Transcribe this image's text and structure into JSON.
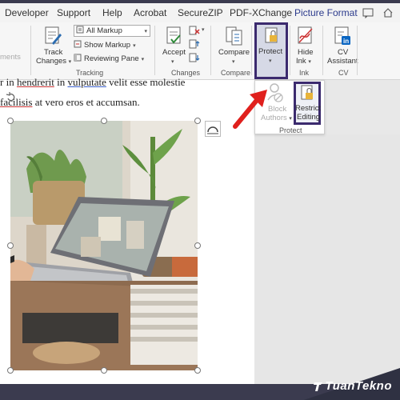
{
  "tabs": [
    "Developer",
    "Support",
    "Help",
    "Acrobat",
    "SecureZIP",
    "PDF-XChange",
    "Picture Format"
  ],
  "ribbon": {
    "comments_partial": "ments",
    "tracking": {
      "track_changes": [
        "Track",
        "Changes"
      ],
      "markup_select": "All Markup",
      "show_markup": "Show Markup",
      "reviewing_pane": "Reviewing Pane",
      "label": "Tracking"
    },
    "changes": {
      "accept": "Accept",
      "label": "Changes"
    },
    "compare": {
      "compare": "Compare",
      "label": "Compare"
    },
    "protect": {
      "protect": "Protect",
      "label": "Protect"
    },
    "ink": {
      "hide_ink": [
        "Hide",
        "Ink"
      ],
      "label": "Ink"
    },
    "cv": {
      "cv_assistant": [
        "CV",
        "Assistant"
      ],
      "label": "CV"
    }
  },
  "dropdown": {
    "block_authors": [
      "Block",
      "Authors"
    ],
    "restrict_editing": [
      "Restrict",
      "Editing"
    ],
    "label": "Protect"
  },
  "document": {
    "line1": {
      "p1": "r in ",
      "w1": "hendrerit",
      "p2": " in ",
      "w2": "vulputate",
      "p3": " velit esse molestie"
    },
    "line2": {
      "w1": "facilisis",
      "p1": " at vero eros et accumsan."
    }
  },
  "brand": "TuanTekno",
  "colors": {
    "highlight": "#3b2a6e",
    "arrow": "#e0201d",
    "accent": "#2b3a8c",
    "word_blue": "#185abd"
  }
}
